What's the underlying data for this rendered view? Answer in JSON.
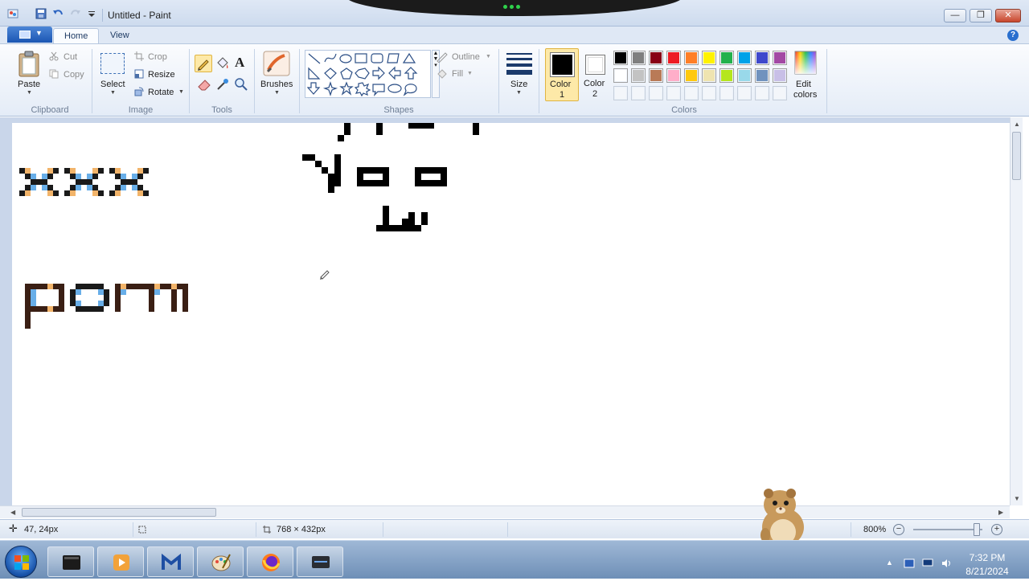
{
  "window": {
    "title": "Untitled - Paint",
    "minimize": "—",
    "maximize": "❐",
    "close": "✕"
  },
  "tabs": {
    "home": "Home",
    "view": "View",
    "help": "?"
  },
  "ribbon": {
    "clipboard": {
      "paste": "Paste",
      "cut": "Cut",
      "copy": "Copy",
      "label": "Clipboard"
    },
    "image": {
      "select": "Select",
      "crop": "Crop",
      "resize": "Resize",
      "rotate": "Rotate",
      "label": "Image"
    },
    "tools": {
      "label": "Tools",
      "text_glyph": "A"
    },
    "brushes": {
      "label": "Brushes"
    },
    "shapes": {
      "outline": "Outline",
      "fill": "Fill",
      "label": "Shapes"
    },
    "size": {
      "label": "Size"
    },
    "colors": {
      "color1": "Color",
      "color1_num": "1",
      "color2": "Color",
      "color2_num": "2",
      "edit_colors_1": "Edit",
      "edit_colors_2": "colors",
      "label": "Colors",
      "color1_value": "#000000",
      "color2_value": "#ffffff",
      "palette_row1": [
        "#000000",
        "#7f7f7f",
        "#880015",
        "#ed1c24",
        "#ff7f27",
        "#fff200",
        "#22b14c",
        "#00a2e8",
        "#3f48cc",
        "#a349a4"
      ],
      "palette_row2": [
        "#ffffff",
        "#c3c3c3",
        "#b97a57",
        "#ffaec9",
        "#ffc90e",
        "#efe4b0",
        "#b5e61d",
        "#99d9ea",
        "#7092be",
        "#c8bfe7"
      ]
    }
  },
  "statusbar": {
    "cursor_pos": "47, 24px",
    "canvas_size": "768 × 432px",
    "zoom": "800%",
    "zoom_out": "−",
    "zoom_in": "+"
  },
  "taskbar": {
    "time": "7:32 PM",
    "date": "8/21/2024"
  }
}
